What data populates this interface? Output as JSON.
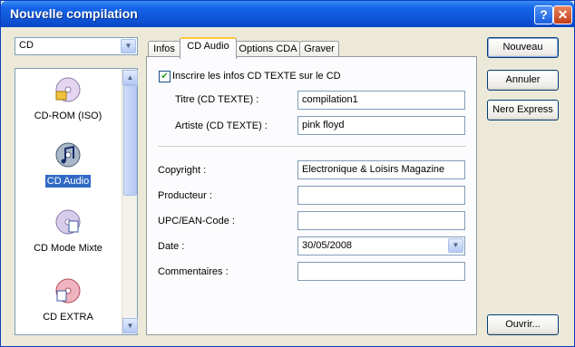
{
  "window": {
    "title": "Nouvelle compilation"
  },
  "titlebar": {
    "help_glyph": "?",
    "close_glyph": "✕"
  },
  "disc_type": {
    "selected": "CD"
  },
  "project_list": [
    {
      "label": "CD-ROM (ISO)",
      "icon": "cd-rom-icon",
      "selected": false
    },
    {
      "label": "CD Audio",
      "icon": "cd-audio-icon",
      "selected": true
    },
    {
      "label": "CD Mode Mixte",
      "icon": "cd-mixed-mode-icon",
      "selected": false
    },
    {
      "label": "CD EXTRA",
      "icon": "cd-extra-icon",
      "selected": false
    }
  ],
  "tabs": [
    {
      "label": "Infos",
      "active": false
    },
    {
      "label": "CD Audio",
      "active": true
    },
    {
      "label": "Options CDA",
      "active": false
    },
    {
      "label": "Graver",
      "active": false
    }
  ],
  "form": {
    "cd_text_checkbox": {
      "label": "Inscrire les infos CD TEXTE sur le CD",
      "checked": true
    },
    "title_label": "Titre (CD TEXTE) :",
    "title_value": "compilation1",
    "artist_label": "Artiste (CD TEXTE) :",
    "artist_value": "pink floyd",
    "copyright_label": "Copyright :",
    "copyright_value": "Electronique & Loisirs Magazine",
    "producer_label": "Producteur :",
    "producer_value": "",
    "upc_label": "UPC/EAN-Code :",
    "upc_value": "",
    "date_label": "Date :",
    "date_value": "30/05/2008",
    "comments_label": "Commentaires :",
    "comments_value": ""
  },
  "buttons": {
    "new": "Nouveau",
    "cancel": "Annuler",
    "nero_express": "Nero Express",
    "open": "Ouvrir..."
  },
  "colors": {
    "title_bar": "#0f54d6",
    "selection": "#316ac5",
    "active_tab_accent": "#ffc83c"
  }
}
